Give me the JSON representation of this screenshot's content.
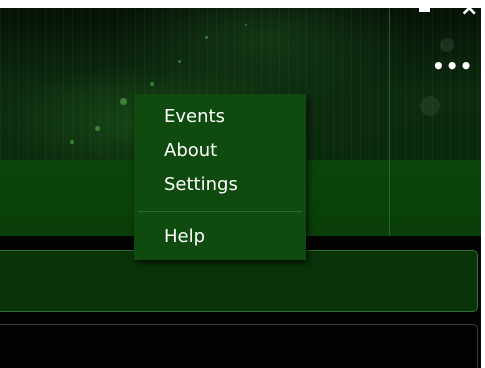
{
  "window": {
    "minimize_label": "",
    "close_label": "×",
    "more_label": "•••"
  },
  "menu": {
    "items": [
      {
        "label": "Events"
      },
      {
        "label": "About"
      },
      {
        "label": "Settings"
      },
      {
        "label": "Help"
      }
    ]
  },
  "colors": {
    "accent": "#0f4a0f",
    "toolbar": "#0a3e0a",
    "text": "#ffffff"
  }
}
